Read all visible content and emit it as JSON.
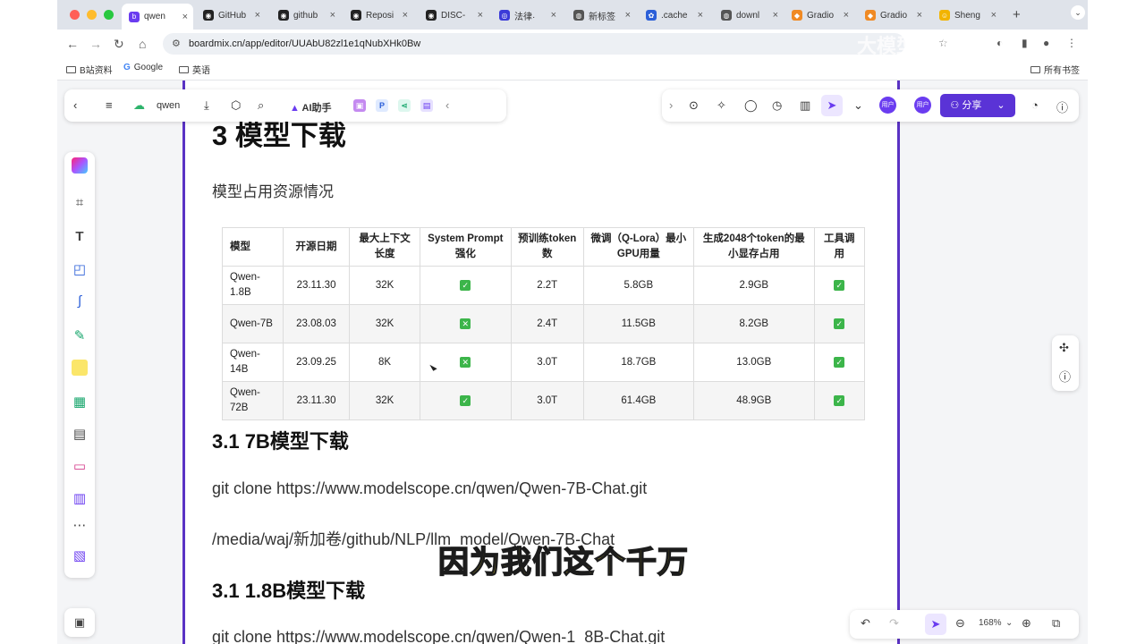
{
  "tabs": [
    {
      "title": "qwen",
      "color": "#6a3cf0",
      "glyph": "b"
    },
    {
      "title": "GitHub",
      "color": "#222222",
      "glyph": "◉"
    },
    {
      "title": "github",
      "color": "#222222",
      "glyph": "◉"
    },
    {
      "title": "Reposi",
      "color": "#222222",
      "glyph": "◉"
    },
    {
      "title": "DISC-",
      "color": "#222222",
      "glyph": "◉"
    },
    {
      "title": "法律·",
      "color": "#3b3bd8",
      "glyph": "◎"
    },
    {
      "title": "新标签",
      "color": "#555555",
      "glyph": "◍"
    },
    {
      "title": ".cache",
      "color": "#2b5fd8",
      "glyph": "✿"
    },
    {
      "title": "downl",
      "color": "#555555",
      "glyph": "◍"
    },
    {
      "title": "Gradio",
      "color": "#f08a24",
      "glyph": "◆"
    },
    {
      "title": "Gradio",
      "color": "#f08a24",
      "glyph": "◆"
    },
    {
      "title": "Sheng",
      "color": "#f2b400",
      "glyph": "☺"
    }
  ],
  "browser": {
    "url": "boardmix.cn/app/editor/UUAbU82zl1e1qNubXHk0Bw",
    "bookmarks": [
      "B站资料",
      "Google",
      "英语"
    ],
    "bookmarks_right": "所有书签"
  },
  "toolbar": {
    "doc_name": "qwen",
    "ai_label": "AI助手",
    "share_label": "分享",
    "user_label": "用户"
  },
  "zoom": "168%",
  "document": {
    "h1": "3 模型下载",
    "subtitle": "模型占用资源情况",
    "table": {
      "headers": [
        "模型",
        "开源日期",
        "最大上下文长度",
        "System Prompt强化",
        "预训练token数",
        "微调（Q-Lora）最小GPU用量",
        "生成2048个token的最小显存占用",
        "工具调用"
      ],
      "rows": [
        {
          "model": "Qwen-1.8B",
          "date": "23.11.30",
          "ctx": "32K",
          "sys": "yes",
          "tokens": "2.2T",
          "gpu": "5.8GB",
          "mem": "2.9GB",
          "tool": "yes"
        },
        {
          "model": "Qwen-7B",
          "date": "23.08.03",
          "ctx": "32K",
          "sys": "no",
          "tokens": "2.4T",
          "gpu": "11.5GB",
          "mem": "8.2GB",
          "tool": "yes"
        },
        {
          "model": "Qwen-14B",
          "date": "23.09.25",
          "ctx": "8K",
          "sys": "no",
          "tokens": "3.0T",
          "gpu": "18.7GB",
          "mem": "13.0GB",
          "tool": "yes"
        },
        {
          "model": "Qwen-72B",
          "date": "23.11.30",
          "ctx": "32K",
          "sys": "yes",
          "tokens": "3.0T",
          "gpu": "61.4GB",
          "mem": "48.9GB",
          "tool": "yes"
        }
      ]
    },
    "h2_a": "3.1 7B模型下载",
    "p_a1": "git clone https://www.modelscope.cn/qwen/Qwen-7B-Chat.git",
    "p_a2": "/media/waj/新加卷/github/NLP/llm_model/Qwen-7B-Chat",
    "h2_b": "3.1 1.8B模型下载",
    "p_b1": "git clone https://www.modelscope.cn/qwen/Qwen-1_8B-Chat.git"
  },
  "video": {
    "subtitle": "因为我们这个千万",
    "watermark": "大模型微调",
    "logo": "bili"
  }
}
